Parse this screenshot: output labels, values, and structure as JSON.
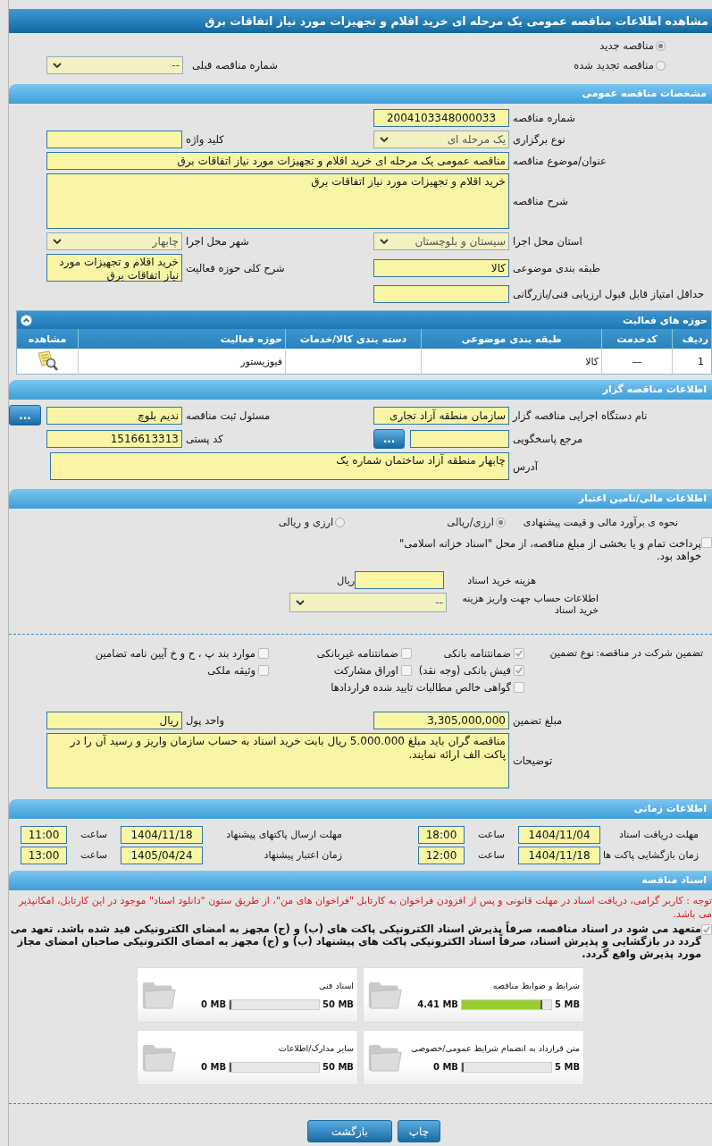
{
  "title": "مشاهده اطلاعات مناقصه عمومی یک مرحله ای خرید اقلام و تجهیزات مورد نیاز اتفاقات برق",
  "tender_kind": [
    {
      "label": "مناقصه جدید",
      "selected": true
    },
    {
      "label": "مناقصه تجدید شده",
      "selected": false
    }
  ],
  "previous_number": {
    "label": "شماره مناقصه قبلی",
    "value": "--"
  },
  "general": {
    "header": "مشخصات مناقصه عمومی",
    "rows": [
      [
        {
          "label": "شماره مناقصه",
          "value": "2004103348000033",
          "kind": "code"
        }
      ],
      [
        {
          "label": "نوع برگزاری",
          "value": "یک مرحله ای",
          "kind": "select"
        },
        {
          "label": "کلید واژه",
          "kind": "input"
        }
      ],
      [
        {
          "label": "عنوان/موضوع مناقصه",
          "value": "مناقصه عمومی یک مرحله ای خرید اقلام و تجهیزات مورد نیاز اتفاقات برق",
          "kind": "wide"
        }
      ],
      [
        {
          "label": "شرح مناقصه",
          "value": "خرید اقلام و تجهیزات مورد نیاز اتفاقات برق",
          "kind": "widearea"
        }
      ],
      [
        {
          "label": "استان محل اجرا",
          "value": "سیستان و بلوچستان",
          "kind": "select"
        },
        {
          "label": "شهر محل اجرا",
          "value": "چابهار",
          "kind": "select"
        }
      ],
      [
        {
          "label": "طبقه بندی موضوعی",
          "value": "کالا",
          "kind": "input"
        },
        {
          "label": "شرح کلی حوزه فعالیت",
          "value": "خرید اقلام و تجهیزات مورد نیاز اتفاقات برق",
          "kind": "area"
        }
      ],
      [
        {
          "label": "حداقل امتیاز قابل قبول ارزیابی فنی/بازرگانی",
          "kind": "input"
        }
      ]
    ]
  },
  "activities": {
    "header": "حوزه های فعالیت",
    "expanded": true,
    "columns": [
      "ردیف",
      "کدخدمت",
      "طبقه بندی موضوعی",
      "دسته بندی کالا/خدمات",
      "حوزه فعالیت",
      "مشاهده"
    ],
    "rows": [
      {
        "index": "1",
        "service_code": "—",
        "category": "کالا",
        "activity": "فیوزیستور"
      }
    ]
  },
  "organizer": {
    "header": "اطلاعات مناقصه گزار",
    "rows": [
      [
        {
          "label": "نام دستگاه اجرایی مناقصه گزار",
          "value": "سازمان منطقه آزاد تجاری",
          "kind": "input"
        },
        {
          "label": "مسئول ثبت مناقصه",
          "value": "ندیم بلوچ",
          "kind": "input",
          "button": "..."
        }
      ],
      [
        {
          "label": "مرجع پاسخگویی",
          "kind": "input",
          "button": "..."
        },
        {
          "label": "کد پستی",
          "value": "1516613313",
          "kind": "input"
        }
      ],
      [
        {
          "label": "آدرس",
          "value": "چابهار منطقه آزاد  ساختمان شماره یک",
          "kind": "widebox"
        }
      ]
    ]
  },
  "finance": {
    "header": "اطلاعات مالی/تامین اعتبار",
    "estimate": {
      "label": "نحوه ی برآورد مالی و قیمت پیشنهادی",
      "options": [
        {
          "label": "ارزی/ریالی",
          "selected": true
        },
        {
          "label": "ارزی و ریالی",
          "selected": false
        }
      ]
    },
    "treasury": {
      "label": "پرداخت تمام و یا بخشی از مبلغ مناقصه، از محل \"اسناد خزانه اسلامی\" خواهد بود.",
      "checked": false
    },
    "doc_cost": {
      "label": "هزینه خرید اسناد",
      "unit": "ریال"
    },
    "account": {
      "label": "اطلاعات حساب جهت واریز هزینه خرید اسناد",
      "value": "--"
    }
  },
  "guarantee": {
    "label": "تضمین شرکت در مناقصه:",
    "type_label": "نوع تضمین",
    "options": [
      {
        "label": "ضمانتنامه بانکی",
        "checked": true
      },
      {
        "label": "ضمانتنامه غیربانکی",
        "checked": false
      },
      {
        "label": "موارد بند پ ، ح و خ آیین نامه تضامین",
        "checked": false
      },
      {
        "label": "فیش بانکی (وجه نقد)",
        "checked": true
      },
      {
        "label": "اوراق مشارکت",
        "checked": false
      },
      {
        "label": "وثیقه ملکی",
        "checked": false
      },
      {
        "label": "گواهی خالص مطالبات تایید شده قراردادها",
        "checked": false
      }
    ],
    "rows": [
      [
        {
          "label": "مبلغ تضمین",
          "value": "3,305,000,000",
          "kind": "input"
        },
        {
          "label": "واحد پول",
          "value": "ریال",
          "kind": "input"
        }
      ],
      [
        {
          "label": "توضیحات",
          "value": "مناقصه گران باید مبلغ 5.000.000 ریال بابت خرید اسناد به حساب سازمان واریز و رسید آن را در پاکت الف ارائه نمایند.",
          "kind": "widearea"
        }
      ]
    ]
  },
  "time": {
    "header": "اطلاعات زمانی",
    "rows": [
      [
        {
          "label": "مهلت دریافت اسناد",
          "date": "1404/11/04",
          "time_label": "ساعت",
          "time": "18:00"
        },
        {
          "label": "مهلت ارسال پاکتهای پیشنهاد",
          "date": "1404/11/18",
          "time_label": "ساعت",
          "time": "11:00"
        }
      ],
      [
        {
          "label": "زمان بازگشایی پاکت ها",
          "date": "1404/11/18",
          "time_label": "ساعت",
          "time": "12:00"
        },
        {
          "label": "زمان اعتبار پیشنهاد",
          "date": "1405/04/24",
          "time_label": "ساعت",
          "time": "13:00"
        }
      ]
    ]
  },
  "documents": {
    "header": "اسناد مناقصه",
    "notice": "توجه : کاربر گرامی، دریافت اسناد در مهلت قانونی و پس از افزودن فراخوان به کارتابل \"فراخوان های من\"، از طریق ستون \"دانلود اسناد\" موجود در این کارتابل، امکانپذیر می باشد.",
    "pledge": {
      "text": "متعهد می شود در اسناد مناقصه، صرفاً پذیرش اسناد الکترونیکی پاکت های (ب) و (ج) مجهز به امضای الکترونیکی قید شده باشد. تعهد می گردد در بازگشایی و پذیرش اسناد، صرفاً اسناد الکترونیکی پاکت های پیشنهاد (ب) و (ج) مجهز به امضای الکترونیکی صاحبان امضای مجاز مورد پذیرش واقع گردد.",
      "checked": true
    },
    "files": [
      {
        "title": "شرایط و ضوابط مناقصه",
        "max": "5 MB",
        "used": "4.41 MB",
        "level": 0.882
      },
      {
        "title": "اسناد فنی",
        "max": "50 MB",
        "used": "0 MB",
        "level": 0
      },
      {
        "title": "متن قرارداد به انضمام شرایط عمومی/خصوصی",
        "max": "5 MB",
        "used": "0 MB",
        "level": 0
      },
      {
        "title": "سایر مدارک/اطلاعات",
        "max": "50 MB",
        "used": "0 MB",
        "level": 0
      }
    ]
  },
  "buttons": [
    "چاپ",
    "بازگشت"
  ]
}
